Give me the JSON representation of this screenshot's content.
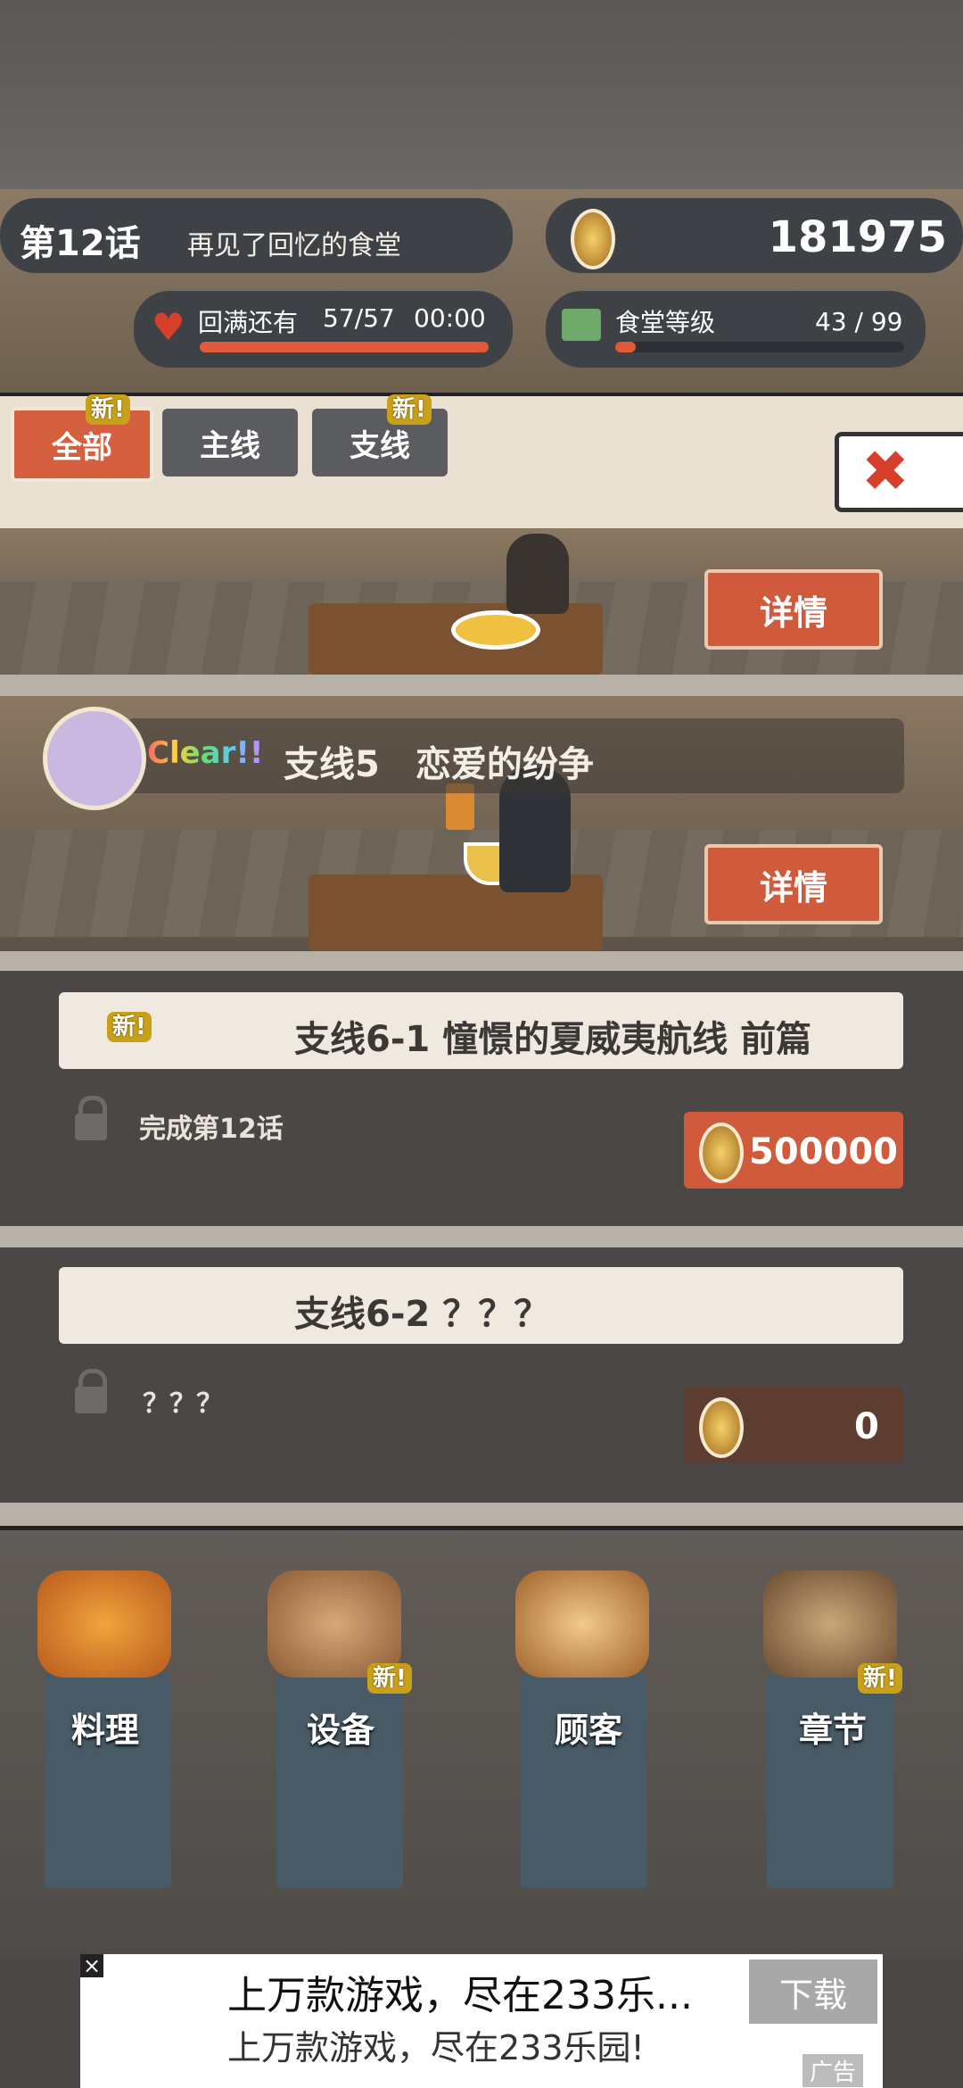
{
  "header": {
    "chapter_num": "第12话",
    "chapter_title": "再见了回忆的食堂",
    "coins": "181975",
    "hp_label": "回满还有",
    "hp_value": "57/57",
    "hp_timer": "00:00",
    "level_label": "食堂等级",
    "level_value": "43 / 99",
    "level_progress": 0.07
  },
  "tabs": [
    {
      "label": "全部",
      "badge": "新!"
    },
    {
      "label": "主线",
      "badge": ""
    },
    {
      "label": "支线",
      "badge": "新!"
    }
  ],
  "close_icon": "close-x-icon",
  "scenes": [
    {
      "detail_label": "详情"
    },
    {
      "clear_tag": "Clear!!",
      "title": "支线5　恋爱的纷争",
      "detail_label": "详情"
    }
  ],
  "quests": [
    {
      "badge": "新!",
      "title": "支线6-1 憧憬的夏威夷航线 前篇",
      "condition": "完成第12话",
      "price": "500000"
    },
    {
      "badge": "",
      "title": "支线6-2 ？？？",
      "condition": "？？？",
      "price": "0"
    }
  ],
  "nav": [
    {
      "label": "料理",
      "badge": ""
    },
    {
      "label": "设备",
      "badge": "新!"
    },
    {
      "label": "顾客",
      "badge": ""
    },
    {
      "label": "章节",
      "badge": "新!"
    }
  ],
  "ad": {
    "title": "上万款游戏，尽在233乐...",
    "subtitle": "上万款游戏，尽在233乐园!",
    "button": "下载",
    "tag": "广告",
    "close": "×"
  }
}
